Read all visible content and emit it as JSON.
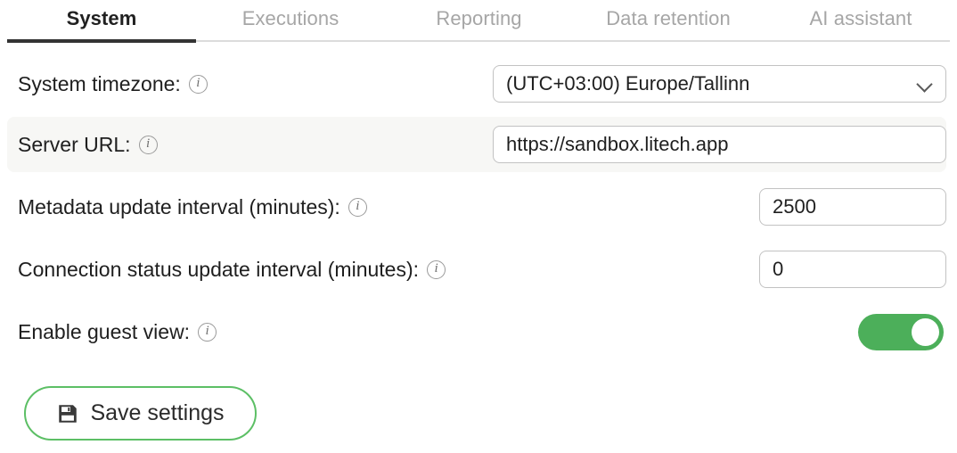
{
  "tabs": [
    {
      "label": "System",
      "active": true
    },
    {
      "label": "Executions",
      "active": false
    },
    {
      "label": "Reporting",
      "active": false
    },
    {
      "label": "Data retention",
      "active": false
    },
    {
      "label": "AI assistant",
      "active": false
    }
  ],
  "settings": {
    "timezone": {
      "label": "System timezone:",
      "info": "i",
      "value": "(UTC+03:00) Europe/Tallinn",
      "chevron": "chevron-down"
    },
    "server_url": {
      "label": "Server URL:",
      "info": "i",
      "value": "https://sandbox.litech.app",
      "placeholder": ""
    },
    "metadata_interval": {
      "label": "Metadata update interval (minutes):",
      "info": "i",
      "value": "2500",
      "placeholder": ""
    },
    "connection_interval": {
      "label": "Connection status update interval (minutes):",
      "info": "i",
      "value": "0",
      "placeholder": ""
    },
    "guest_view": {
      "label": "Enable guest view:",
      "info": "i",
      "state": "on"
    }
  },
  "actions": {
    "save_label": "Save settings",
    "save_icon": "floppy-disk-icon"
  },
  "colors": {
    "accent_green": "#4caf5a",
    "save_border": "#5cbf65",
    "active_tab_underline": "#333333",
    "inactive_tab_text": "#a6a6a6",
    "stripe_bg": "#f7f7f5",
    "input_border": "#c2c2c2"
  }
}
